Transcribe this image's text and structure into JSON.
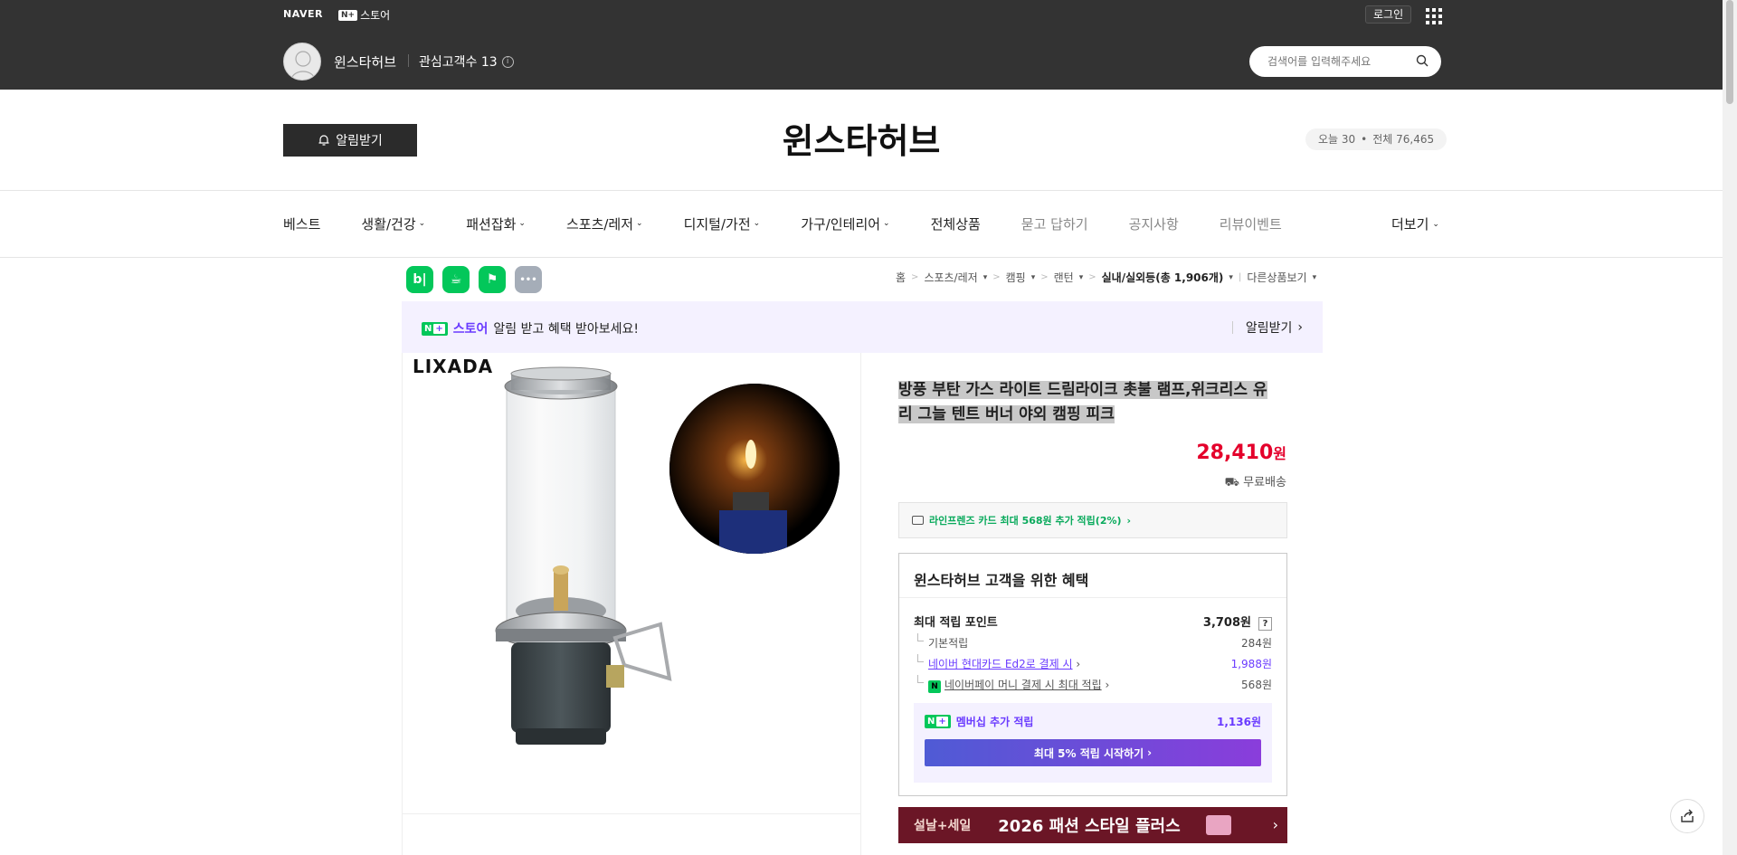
{
  "top": {
    "naver_logo": "NAVER",
    "nstore_badge": "N+",
    "nstore_label": "스토어",
    "login": "로그인",
    "store_name": "윈스타허브",
    "fav_label": "관심고객수 13",
    "search_placeholder": "검색어를 입력해주세요"
  },
  "header": {
    "alarm_button": "알림받기",
    "title": "윈스타허브",
    "today": "오늘 30",
    "dot": "•",
    "total": "전체 76,465"
  },
  "nav": {
    "items": [
      {
        "label": "베스트",
        "chevron": false,
        "gray": false
      },
      {
        "label": "생활/건강",
        "chevron": true,
        "gray": false
      },
      {
        "label": "패션잡화",
        "chevron": true,
        "gray": false
      },
      {
        "label": "스포츠/레저",
        "chevron": true,
        "gray": false
      },
      {
        "label": "디지털/가전",
        "chevron": true,
        "gray": false
      },
      {
        "label": "가구/인테리어",
        "chevron": true,
        "gray": false
      },
      {
        "label": "전체상품",
        "chevron": false,
        "gray": false
      },
      {
        "label": "묻고 답하기",
        "chevron": false,
        "gray": true
      },
      {
        "label": "공지사항",
        "chevron": false,
        "gray": true
      },
      {
        "label": "리뷰이벤트",
        "chevron": false,
        "gray": true
      }
    ],
    "more": "더보기"
  },
  "quick_icons": {
    "blog": "b|",
    "cafe": "☕",
    "bookmark": "⚑",
    "more": "•••"
  },
  "breadcrumb": {
    "home": "홈",
    "c1": "스포츠/레저",
    "c2": "캠핑",
    "c3": "랜턴",
    "c4": "실내/실외등(총 1,906개)",
    "other": "다른상품보기"
  },
  "promo": {
    "badge": "N",
    "store": "스토어",
    "text": "알림 받고 혜택 받아보세요!",
    "action": "알림받기"
  },
  "product": {
    "brand": "LIXADA",
    "title": "방풍 부탄 가스 라이트 드림라이크 촛불 램프,위크리스 유리 그늘 텐트 버너 야외 캠핑 피크",
    "price": "28,410",
    "price_unit": "원",
    "shipping": "무료배송",
    "card_benefit": "라인프렌즈 카드 최대 568원 추가 적립(2%)"
  },
  "benefits": {
    "title": "윈스타허브 고객을 위한 혜택",
    "max_point_label": "최대 적립 포인트",
    "max_point_value": "3,708원",
    "q": "?",
    "basic_label": "기본적립",
    "basic_value": "284원",
    "hyundai_label": "네이버 현대카드 Ed2로 결제 시",
    "hyundai_value": "1,988원",
    "pay_label": "네이버페이 머니 결제 시 최대 적립",
    "pay_value": "568원",
    "member_label": "멤버십 추가 적립",
    "member_value": "1,136원",
    "member_button": "최대 5% 적립 시작하기"
  },
  "banner": {
    "left": "설날+세일",
    "main": "2026 패션 스타일 플러스"
  },
  "colors": {
    "topbar": "#333333",
    "price_red": "#e4002b",
    "naver_green": "#03c75a",
    "purple": "#6a3bff",
    "banner": "#6b1626"
  }
}
